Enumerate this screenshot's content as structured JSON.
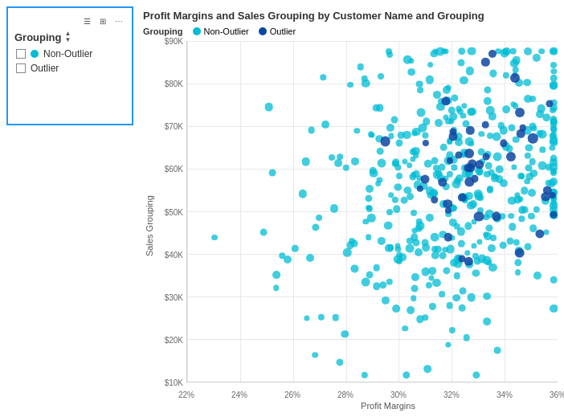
{
  "sidebar": {
    "title": "Grouping",
    "toolbar_icons": [
      "lines-icon",
      "table-icon",
      "more-icon"
    ],
    "filters": [
      {
        "label": "Non-Outlier",
        "color": "#00BCD4",
        "checked": false
      },
      {
        "label": "Outlier",
        "color": "#0D47A1",
        "checked": false
      }
    ]
  },
  "chart": {
    "title": "Profit Margins and Sales Grouping by Customer Name and Grouping",
    "legend_label": "Grouping",
    "legend_items": [
      {
        "label": "Non-Outlier",
        "color": "#00BCD4"
      },
      {
        "label": "Outlier",
        "color": "#0D47A1"
      }
    ],
    "y_axis": {
      "label": "Sales Grouping",
      "ticks": [
        "$90K",
        "$80K",
        "$70K",
        "$60K",
        "$50K",
        "$40K",
        "$30K",
        "$20K",
        "$10K"
      ]
    },
    "x_axis": {
      "label": "Profit Margins",
      "ticks": [
        "22%",
        "24%",
        "26%",
        "28%",
        "30%",
        "32%",
        "34%",
        "36%"
      ]
    }
  }
}
